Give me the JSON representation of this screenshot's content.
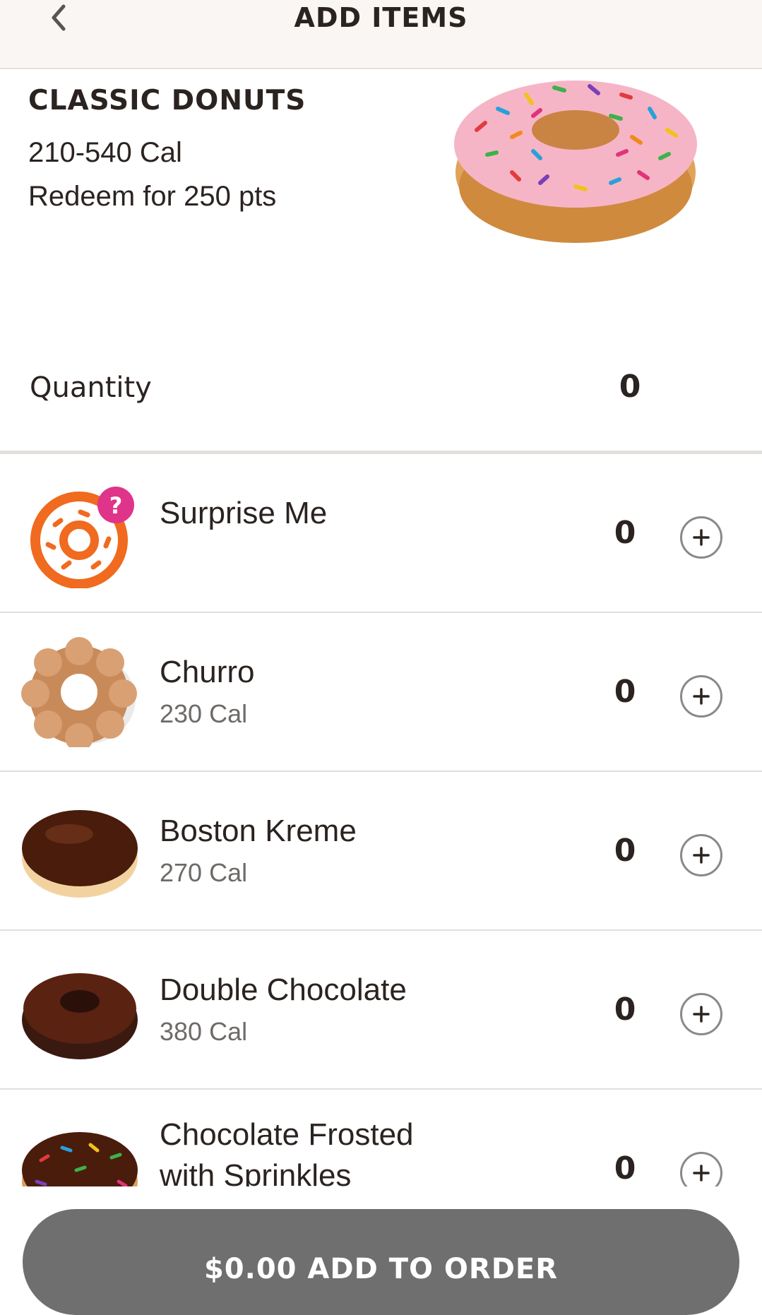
{
  "header": {
    "title": "ADD ITEMS",
    "back_icon": "chevron-left-icon"
  },
  "product": {
    "name": "CLASSIC DONUTS",
    "calories": "210-540 Cal",
    "points": "Redeem for 250 pts",
    "quantity_label": "Quantity",
    "quantity_value": "0"
  },
  "items": [
    {
      "name": "Surprise Me",
      "calories": "",
      "qty": "0",
      "icon": "surprise-donut-icon"
    },
    {
      "name": "Churro",
      "calories": "230 Cal",
      "qty": "0",
      "icon": "churro-donut-image"
    },
    {
      "name": "Boston Kreme",
      "calories": "270 Cal",
      "qty": "0",
      "icon": "boston-kreme-image"
    },
    {
      "name": "Double Chocolate",
      "calories": "380 Cal",
      "qty": "0",
      "icon": "double-chocolate-image"
    },
    {
      "name": "Chocolate Frosted\nwith Sprinkles",
      "name_line1": "Chocolate Frosted",
      "name_line2": "with Sprinkles",
      "calories": "",
      "qty": "0",
      "icon": "chocolate-sprinkles-image"
    }
  ],
  "cta": {
    "label": "$0.00 ADD TO ORDER"
  },
  "colors": {
    "accent_orange": "#f06a1f",
    "accent_pink": "#e0338a",
    "cta_bg": "#6f6f6f"
  }
}
